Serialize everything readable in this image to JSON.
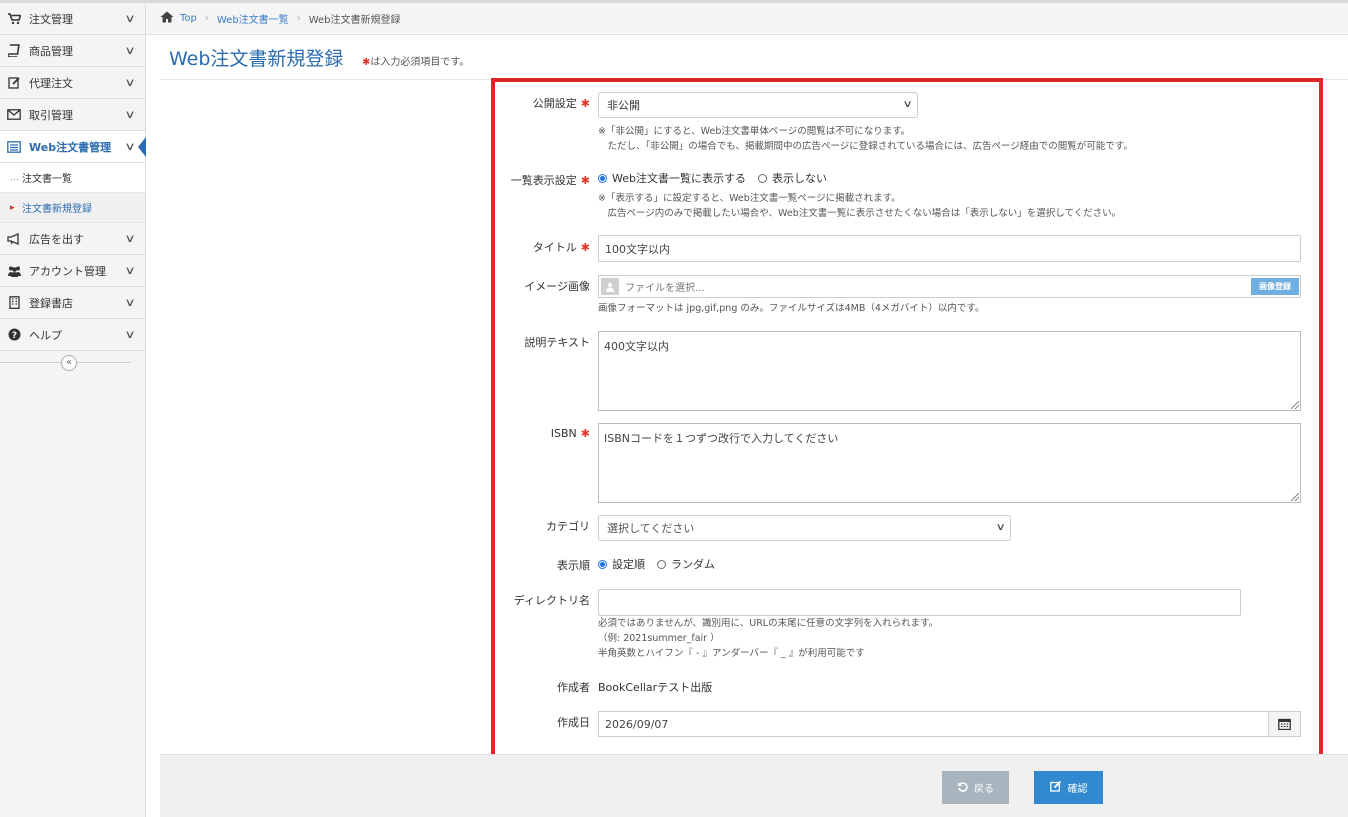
{
  "sidebar": {
    "items": [
      {
        "label": "注文管理",
        "icon": "cart-icon"
      },
      {
        "label": "商品管理",
        "icon": "book-icon"
      },
      {
        "label": "代理注文",
        "icon": "edit-icon"
      },
      {
        "label": "取引管理",
        "icon": "mail-icon"
      },
      {
        "label": "Web注文書管理",
        "icon": "list-icon"
      },
      {
        "label": "広告を出す",
        "icon": "megaphone-icon"
      },
      {
        "label": "アカウント管理",
        "icon": "users-icon"
      },
      {
        "label": "登録書店",
        "icon": "building-icon"
      },
      {
        "label": "ヘルプ",
        "icon": "question-icon"
      }
    ],
    "subitems": [
      {
        "label": "注文書一覧"
      },
      {
        "label": "注文書新規登録"
      }
    ],
    "collapse": "«",
    "chevron": "∨"
  },
  "breadcrumb": {
    "home": "Top",
    "sep": "›",
    "level1": "Web注文書一覧",
    "current": "Web注文書新規登録"
  },
  "header": {
    "title": "Web注文書新規登録",
    "required_star": "✱",
    "required_note": "は入力必須項目です。"
  },
  "form": {
    "publish": {
      "label": "公開設定",
      "value": "非公開",
      "help": "※「非公開」にすると、Web注文書単体ページの閲覧は不可になります。\n　ただし、「非公開」の場合でも、掲載期間中の広告ページに登録されている場合には、広告ページ経由での閲覧が可能です。"
    },
    "list_display": {
      "label": "一覧表示設定",
      "option_show": "Web注文書一覧に表示する",
      "option_hide": "表示しない",
      "help": "※「表示する」に設定すると、Web注文書一覧ページに掲載されます。\n　広告ページ内のみで掲載したい場合や、Web注文書一覧に表示させたくない場合は「表示しない」を選択してください。"
    },
    "title_field": {
      "label": "タイトル",
      "placeholder": "100文字以内"
    },
    "image": {
      "label": "イメージ画像",
      "placeholder": "ファイルを選択...",
      "button": "画像登録",
      "help": "画像フォーマットは jpg,gif,png のみ。ファイルサイズは4MB（4メガバイト）以内です。"
    },
    "description": {
      "label": "説明テキスト",
      "placeholder": "400文字以内"
    },
    "isbn": {
      "label": "ISBN",
      "placeholder": "ISBNコードを１つずつ改行で入力してください"
    },
    "category": {
      "label": "カテゴリ",
      "value": "選択してください"
    },
    "order": {
      "label": "表示順",
      "option_set": "設定順",
      "option_random": "ランダム"
    },
    "directory": {
      "label": "ディレクトリ名",
      "value": "",
      "help": "必須ではありませんが、識別用に、URLの末尾に任意の文字列を入れられます。\n（例: 2021summer_fair ）\n半角英数とハイフン『 - 』アンダーバー『 _ 』が利用可能です"
    },
    "author": {
      "label": "作成者",
      "value": "BookCellarテスト出版"
    },
    "created": {
      "label": "作成日",
      "value": "2026/09/07"
    }
  },
  "footer": {
    "back": "戻る",
    "confirm": "確認"
  },
  "colors": {
    "accent": "#2b6cb0",
    "required": "#e0392b",
    "frame": "#e0262b",
    "confirm_button": "#3389cf",
    "back_button": "#a9b5be"
  }
}
